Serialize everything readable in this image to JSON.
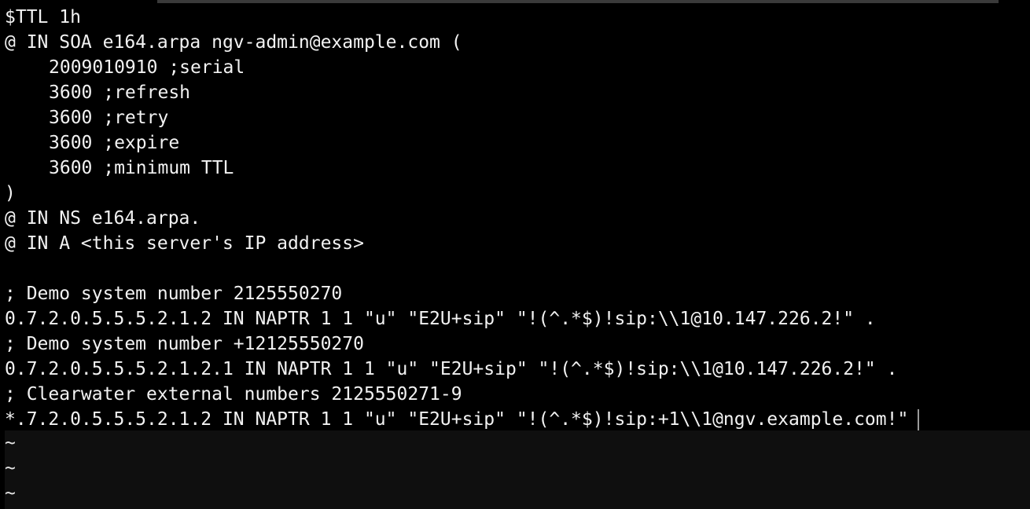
{
  "editor": {
    "lines": [
      "$TTL 1h",
      "@ IN SOA e164.arpa ngv-admin@example.com (",
      "2009010910 ;serial",
      "3600 ;refresh",
      "3600 ;retry",
      "3600 ;expire",
      "3600 ;minimum TTL",
      ")",
      "@ IN NS e164.arpa.",
      "@ IN A <this server's IP address>",
      "",
      "; Demo system number 2125550270",
      "0.7.2.0.5.5.5.2.1.2 IN NAPTR 1 1 \"u\" \"E2U+sip\" \"!(^.*$)!sip:\\\\1@10.147.226.2!\" .",
      "; Demo system number +12125550270",
      "0.7.2.0.5.5.5.2.1.2.1 IN NAPTR 1 1 \"u\" \"E2U+sip\" \"!(^.*$)!sip:\\\\1@10.147.226.2!\" .",
      "; Clearwater external numbers 2125550271-9",
      "*.7.2.0.5.5.5.2.1.2 IN NAPTR 1 1 \"u\" \"E2U+sip\" \"!(^.*$)!sip:+1\\\\1@ngv.example.com!\""
    ],
    "empty_line_marker": "~",
    "empty_line_count": 3
  }
}
